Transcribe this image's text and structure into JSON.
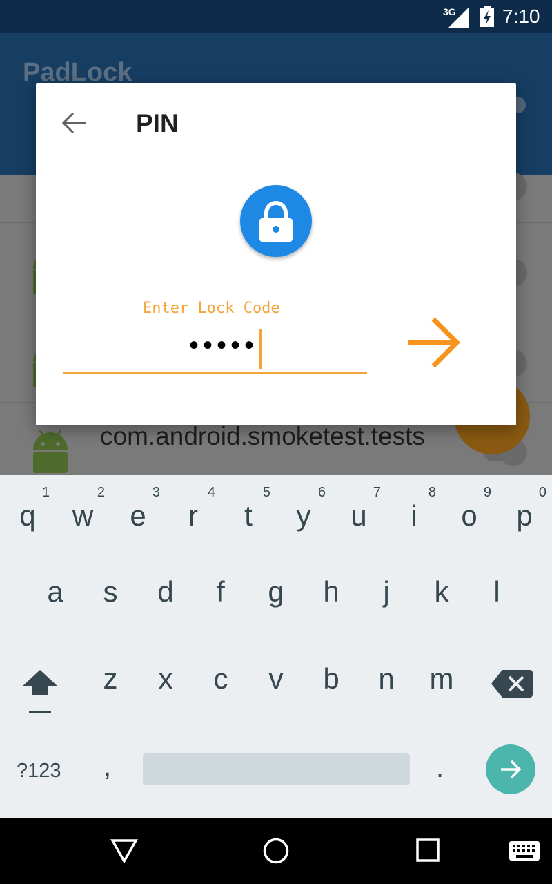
{
  "status_bar": {
    "network": "3G",
    "time": "7:10"
  },
  "app": {
    "title": "PadLock"
  },
  "background_list": {
    "items": [
      {
        "package": "com.android.smoketest.tests"
      }
    ]
  },
  "dialog": {
    "title": "PIN",
    "input_hint": "Enter Lock Code",
    "masked_value": "•••••",
    "entered_length": 5
  },
  "keyboard": {
    "row1": [
      {
        "ch": "q",
        "num": "1"
      },
      {
        "ch": "w",
        "num": "2"
      },
      {
        "ch": "e",
        "num": "3"
      },
      {
        "ch": "r",
        "num": "4"
      },
      {
        "ch": "t",
        "num": "5"
      },
      {
        "ch": "y",
        "num": "6"
      },
      {
        "ch": "u",
        "num": "7"
      },
      {
        "ch": "i",
        "num": "8"
      },
      {
        "ch": "o",
        "num": "9"
      },
      {
        "ch": "p",
        "num": "0"
      }
    ],
    "row2": [
      "a",
      "s",
      "d",
      "f",
      "g",
      "h",
      "j",
      "k",
      "l"
    ],
    "row3": [
      "z",
      "x",
      "c",
      "v",
      "b",
      "n",
      "m"
    ],
    "symbols_label": "?123",
    "comma": ",",
    "period": "."
  },
  "colors": {
    "accent": "#f7941d",
    "lock_blue": "#1e88e5",
    "enter_teal": "#4db6ac",
    "app_bar": "#163e63"
  }
}
